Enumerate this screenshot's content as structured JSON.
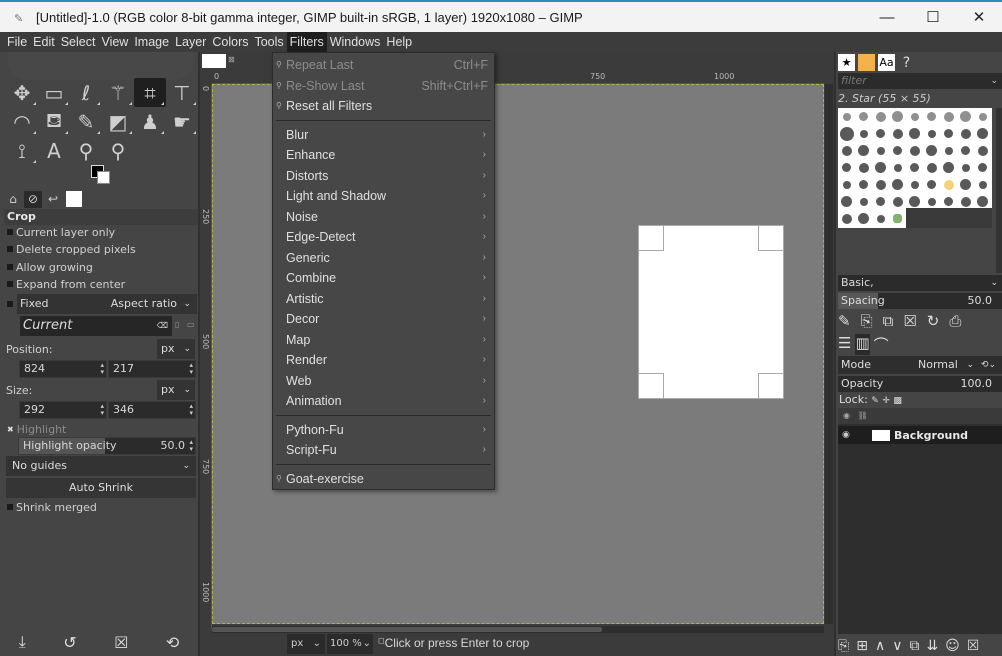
{
  "window": {
    "title": "[Untitled]-1.0 (RGB color 8-bit gamma integer, GIMP built-in sRGB, 1 layer) 1920x1080 – GIMP",
    "minimize": "—",
    "maximize": "☐",
    "close": "✕"
  },
  "menubar": {
    "items": [
      "File",
      "Edit",
      "Select",
      "View",
      "Image",
      "Layer",
      "Colors",
      "Tools",
      "Filters",
      "Windows",
      "Help"
    ],
    "active": "Filters"
  },
  "toolbox": {
    "tools": [
      {
        "name": "move-tool",
        "glyph": "✥"
      },
      {
        "name": "rect-select-tool",
        "glyph": "▭"
      },
      {
        "name": "free-select-tool",
        "glyph": "ℓ"
      },
      {
        "name": "fuzzy-select-tool",
        "glyph": "⚚"
      },
      {
        "name": "crop-tool",
        "glyph": "⌗"
      },
      {
        "name": "unified-transform-tool",
        "glyph": "⊤"
      },
      {
        "name": "warp-transform-tool",
        "glyph": "◠"
      },
      {
        "name": "bucket-fill-tool",
        "glyph": "⛾"
      },
      {
        "name": "paintbrush-tool",
        "glyph": "✎"
      },
      {
        "name": "eraser-tool",
        "glyph": "◩"
      },
      {
        "name": "clone-tool",
        "glyph": "♟"
      },
      {
        "name": "smudge-tool",
        "glyph": "☛"
      },
      {
        "name": "paths-tool",
        "glyph": "⟟"
      },
      {
        "name": "text-tool",
        "glyph": "A"
      },
      {
        "name": "color-picker-tool",
        "glyph": "⚲"
      },
      {
        "name": "zoom-tool",
        "glyph": "⚲"
      }
    ],
    "options_title": "Crop",
    "options": {
      "current_layer_only": "Current layer only",
      "delete_cropped_pixels": "Delete cropped pixels",
      "allow_growing": "Allow growing",
      "expand_from_center": "Expand from center",
      "fixed": "Fixed",
      "fixed_mode": "Aspect ratio",
      "aspect_value": "Current",
      "position_label": "Position:",
      "position_unit": "px",
      "position_x": "824",
      "position_y": "217",
      "size_label": "Size:",
      "size_unit": "px",
      "size_w": "292",
      "size_h": "346",
      "highlight": "Highlight",
      "highlight_opacity_label": "Highlight opacity",
      "highlight_opacity_value": "50.0",
      "guides": "No guides",
      "auto_shrink": "Auto Shrink",
      "shrink_merged": "Shrink merged"
    },
    "bottom_buttons": [
      "save-preset",
      "restore-preset",
      "delete-preset",
      "reset"
    ]
  },
  "canvas": {
    "ruler_h": [
      "0",
      "750",
      "1000"
    ],
    "ruler_v": [
      "0",
      "250",
      "500",
      "750",
      "1000"
    ],
    "unit": "px",
    "zoom": "100 %",
    "status": "Click or press Enter to crop"
  },
  "filters_menu": {
    "top": [
      {
        "label": "Repeat Last",
        "shortcut": "Ctrl+F",
        "disabled": true
      },
      {
        "label": "Re-Show Last",
        "shortcut": "Shift+Ctrl+F",
        "disabled": true
      },
      {
        "label": "Reset all Filters",
        "shortcut": "",
        "disabled": false
      }
    ],
    "submenus": [
      "Blur",
      "Enhance",
      "Distorts",
      "Light and Shadow",
      "Noise",
      "Edge-Detect",
      "Generic",
      "Combine",
      "Artistic",
      "Decor",
      "Map",
      "Render",
      "Web",
      "Animation"
    ],
    "scripts": [
      "Python-Fu",
      "Script-Fu"
    ],
    "plugins": [
      "Goat-exercise"
    ]
  },
  "right_dock": {
    "filter_placeholder": "filter",
    "brush_name": "2. Star (55 × 55)",
    "preset": "Basic,",
    "spacing_label": "Spacing",
    "spacing_value": "50.0",
    "mode_label": "Mode",
    "mode_value": "Normal",
    "opacity_label": "Opacity",
    "opacity_value": "100.0",
    "lock_label": "Lock:",
    "layers": [
      {
        "name": "Background",
        "visible": true
      }
    ]
  }
}
